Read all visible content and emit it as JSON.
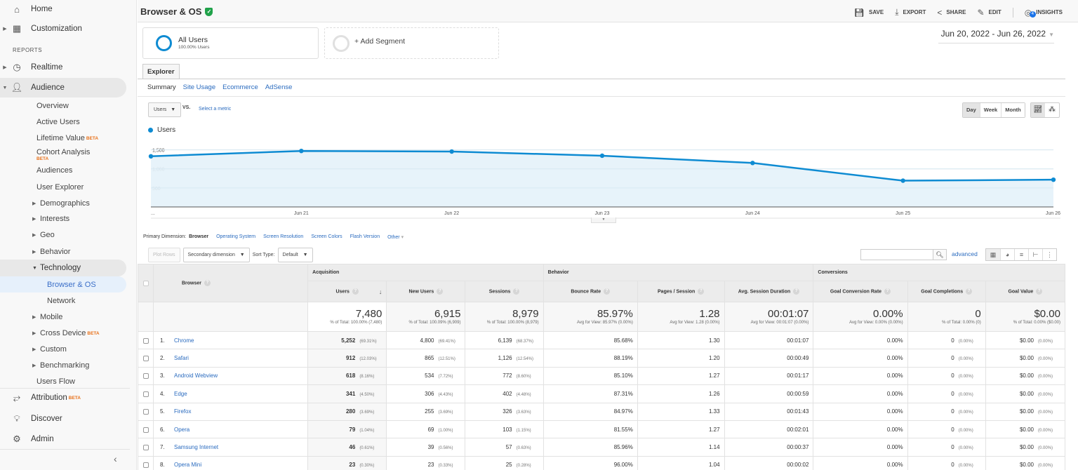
{
  "sidebar": {
    "home": "Home",
    "customization": "Customization",
    "reports_label": "REPORTS",
    "realtime": "Realtime",
    "audience": "Audience",
    "audience_items": [
      "Overview",
      "Active Users",
      "Lifetime Value",
      "Cohort Analysis",
      "Audiences",
      "User Explorer"
    ],
    "audience_groups": [
      "Demographics",
      "Interests",
      "Geo",
      "Behavior"
    ],
    "technology": "Technology",
    "technology_items": [
      "Browser & OS",
      "Network"
    ],
    "more_groups": [
      "Mobile",
      "Cross Device",
      "Custom",
      "Benchmarking"
    ],
    "users_flow": "Users Flow",
    "attribution": "Attribution",
    "discover": "Discover",
    "admin": "Admin",
    "beta": "BETA",
    "collapse": "‹"
  },
  "header": {
    "title": "Browser & OS",
    "actions": [
      "SAVE",
      "EXPORT",
      "SHARE",
      "EDIT",
      "INSIGHTS"
    ],
    "insights_count": "4"
  },
  "segments": {
    "active_name": "All Users",
    "active_sub": "100.00% Users",
    "add_label": "+ Add Segment"
  },
  "date_range": "Jun 20, 2022 - Jun 26, 2022",
  "tabs": {
    "explorer": "Explorer",
    "subtabs": [
      "Summary",
      "Site Usage",
      "Ecommerce",
      "AdSense"
    ]
  },
  "chart_controls": {
    "metric": "Users",
    "vs": "VS.",
    "select_metric": "Select a metric",
    "periods": [
      "Day",
      "Week",
      "Month"
    ],
    "view_icons": [
      "line-chart-icon",
      "motion-chart-icon"
    ]
  },
  "chart_data": {
    "type": "area",
    "title": "",
    "legend": [
      "Users"
    ],
    "legend_position": "top-left",
    "x": [
      "Jun 20",
      "Jun 21",
      "Jun 22",
      "Jun 23",
      "Jun 24",
      "Jun 25",
      "Jun 26"
    ],
    "x_tick_labels": [
      "...",
      "Jun 21",
      "Jun 22",
      "Jun 23",
      "Jun 24",
      "Jun 25",
      "Jun 26"
    ],
    "series": [
      {
        "name": "Users",
        "values": [
          1330,
          1470,
          1455,
          1345,
          1155,
          690,
          715
        ],
        "color": "#0e8bd2"
      }
    ],
    "y_ticks": [
      500,
      1000,
      1500
    ],
    "y_tick_labels": [
      "500",
      "1,000",
      "1,500"
    ],
    "ylim": [
      0,
      1750
    ],
    "grid": true
  },
  "dimensions": {
    "label": "Primary Dimension:",
    "current": "Browser",
    "others": [
      "Operating System",
      "Screen Resolution",
      "Screen Colors",
      "Flash Version",
      "Other"
    ]
  },
  "table_controls": {
    "plot_rows": "Plot Rows",
    "secondary": "Secondary dimension",
    "sort_type_label": "Sort Type:",
    "sort_type": "Default",
    "search_value": "",
    "advanced": "advanced"
  },
  "table": {
    "dim_header": "Browser",
    "groups": [
      "Acquisition",
      "Behavior",
      "Conversions"
    ],
    "columns": [
      "Users",
      "New Users",
      "Sessions",
      "Bounce Rate",
      "Pages / Session",
      "Avg. Session Duration",
      "Goal Conversion Rate",
      "Goal Completions",
      "Goal Value"
    ],
    "totals": [
      {
        "value": "7,480",
        "sub": "% of Total: 100.00% (7,480)"
      },
      {
        "value": "6,915",
        "sub": "% of Total: 100.09% (6,909)"
      },
      {
        "value": "8,979",
        "sub": "% of Total: 100.00% (8,979)"
      },
      {
        "value": "85.97%",
        "sub": "Avg for View: 85.97% (0.00%)"
      },
      {
        "value": "1.28",
        "sub": "Avg for View: 1.28 (0.00%)"
      },
      {
        "value": "00:01:07",
        "sub": "Avg for View: 00:01:07 (0.00%)"
      },
      {
        "value": "0.00%",
        "sub": "Avg for View: 0.00% (0.00%)"
      },
      {
        "value": "0",
        "sub": "% of Total: 0.00% (0)"
      },
      {
        "value": "$0.00",
        "sub": "% of Total: 0.00% ($0.00)"
      }
    ],
    "rows": [
      {
        "idx": "1.",
        "name": "Chrome",
        "users": "5,252",
        "users_pct": "(69.31%)",
        "new_users": "4,800",
        "new_users_pct": "(69.41%)",
        "sessions": "6,139",
        "sessions_pct": "(68.37%)",
        "bounce": "85.68%",
        "pages": "1.30",
        "duration": "00:01:07",
        "conv": "0.00%",
        "goals": "0",
        "goals_pct": "(0.00%)",
        "value": "$0.00",
        "value_pct": "(0.00%)"
      },
      {
        "idx": "2.",
        "name": "Safari",
        "users": "912",
        "users_pct": "(12.03%)",
        "new_users": "865",
        "new_users_pct": "(12.51%)",
        "sessions": "1,126",
        "sessions_pct": "(12.54%)",
        "bounce": "88.19%",
        "pages": "1.20",
        "duration": "00:00:49",
        "conv": "0.00%",
        "goals": "0",
        "goals_pct": "(0.00%)",
        "value": "$0.00",
        "value_pct": "(0.00%)"
      },
      {
        "idx": "3.",
        "name": "Android Webview",
        "users": "618",
        "users_pct": "(8.16%)",
        "new_users": "534",
        "new_users_pct": "(7.72%)",
        "sessions": "772",
        "sessions_pct": "(8.60%)",
        "bounce": "85.10%",
        "pages": "1.27",
        "duration": "00:01:17",
        "conv": "0.00%",
        "goals": "0",
        "goals_pct": "(0.00%)",
        "value": "$0.00",
        "value_pct": "(0.00%)"
      },
      {
        "idx": "4.",
        "name": "Edge",
        "users": "341",
        "users_pct": "(4.50%)",
        "new_users": "306",
        "new_users_pct": "(4.43%)",
        "sessions": "402",
        "sessions_pct": "(4.48%)",
        "bounce": "87.31%",
        "pages": "1.26",
        "duration": "00:00:59",
        "conv": "0.00%",
        "goals": "0",
        "goals_pct": "(0.00%)",
        "value": "$0.00",
        "value_pct": "(0.00%)"
      },
      {
        "idx": "5.",
        "name": "Firefox",
        "users": "280",
        "users_pct": "(3.69%)",
        "new_users": "255",
        "new_users_pct": "(3.69%)",
        "sessions": "326",
        "sessions_pct": "(3.63%)",
        "bounce": "84.97%",
        "pages": "1.33",
        "duration": "00:01:43",
        "conv": "0.00%",
        "goals": "0",
        "goals_pct": "(0.00%)",
        "value": "$0.00",
        "value_pct": "(0.00%)"
      },
      {
        "idx": "6.",
        "name": "Opera",
        "users": "79",
        "users_pct": "(1.04%)",
        "new_users": "69",
        "new_users_pct": "(1.00%)",
        "sessions": "103",
        "sessions_pct": "(1.15%)",
        "bounce": "81.55%",
        "pages": "1.27",
        "duration": "00:02:01",
        "conv": "0.00%",
        "goals": "0",
        "goals_pct": "(0.00%)",
        "value": "$0.00",
        "value_pct": "(0.00%)"
      },
      {
        "idx": "7.",
        "name": "Samsung Internet",
        "users": "46",
        "users_pct": "(0.61%)",
        "new_users": "39",
        "new_users_pct": "(0.56%)",
        "sessions": "57",
        "sessions_pct": "(0.63%)",
        "bounce": "85.96%",
        "pages": "1.14",
        "duration": "00:00:37",
        "conv": "0.00%",
        "goals": "0",
        "goals_pct": "(0.00%)",
        "value": "$0.00",
        "value_pct": "(0.00%)"
      },
      {
        "idx": "8.",
        "name": "Opera Mini",
        "users": "23",
        "users_pct": "(0.30%)",
        "new_users": "23",
        "new_users_pct": "(0.33%)",
        "sessions": "25",
        "sessions_pct": "(0.28%)",
        "bounce": "96.00%",
        "pages": "1.04",
        "duration": "00:00:02",
        "conv": "0.00%",
        "goals": "0",
        "goals_pct": "(0.00%)",
        "value": "$0.00",
        "value_pct": "(0.00%)"
      }
    ]
  }
}
